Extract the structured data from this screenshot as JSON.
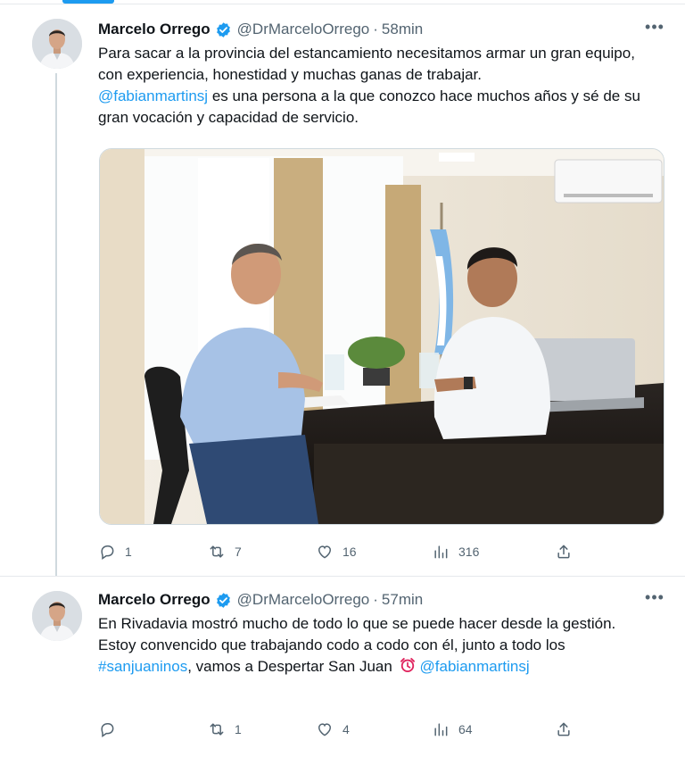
{
  "tweets": [
    {
      "author": {
        "name": "Marcelo Orrego",
        "handle": "@DrMarceloOrrego",
        "time": "58min",
        "separator": "·",
        "avatar_icon": "person-avatar",
        "verified_icon": "verified-badge-icon"
      },
      "text": {
        "line1": "Para sacar a la provincia del estancamiento necesitamos armar un gran equipo, con experiencia, honestidad y muchas ganas de trabajar.",
        "mention": "@fabianmartinsj",
        "line2_rest": " es una persona a la que conozco hace muchos años y sé de su gran vocación y capacidad de servicio."
      },
      "media": {
        "icon": "photo-two-men-meeting-office"
      },
      "actions": {
        "replies": "1",
        "retweets": "7",
        "likes": "16",
        "views": "316"
      }
    },
    {
      "author": {
        "name": "Marcelo Orrego",
        "handle": "@DrMarceloOrrego",
        "time": "57min",
        "separator": "·",
        "avatar_icon": "person-avatar",
        "verified_icon": "verified-badge-icon"
      },
      "text": {
        "line1": "En Rivadavia mostró mucho de todo lo que se puede hacer desde la gestión.",
        "line2_prefix": "Estoy convencido que trabajando codo a codo con él, junto a todo los ",
        "hashtag": "#sanjuaninos",
        "line2_mid": ", vamos a Despertar San Juan ",
        "emoji_icon": "alarm-clock-icon",
        "mention": "@fabianmartinsj"
      },
      "actions": {
        "replies": "",
        "retweets": "1",
        "likes": "4",
        "views": "64"
      }
    }
  ],
  "colors": {
    "accent": "#1d9bf0",
    "text": "#0f1419",
    "secondary": "#536471",
    "divider": "#e6e9ec"
  }
}
